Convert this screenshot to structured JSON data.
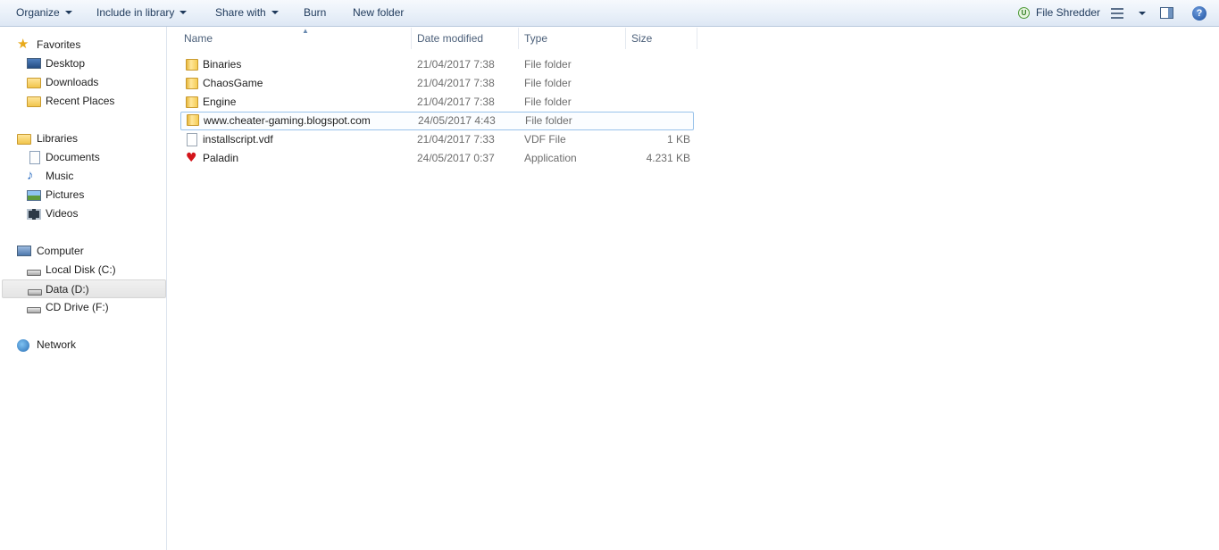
{
  "toolbar": {
    "organize": "Organize",
    "include_in_library": "Include in library",
    "share_with": "Share with",
    "burn": "Burn",
    "new_folder": "New folder",
    "file_shredder": "File Shredder",
    "file_shredder_icon_letter": "U",
    "help_glyph": "?"
  },
  "nav": {
    "favorites": {
      "label": "Favorites",
      "items": [
        "Desktop",
        "Downloads",
        "Recent Places"
      ]
    },
    "libraries": {
      "label": "Libraries",
      "items": [
        "Documents",
        "Music",
        "Pictures",
        "Videos"
      ]
    },
    "computer": {
      "label": "Computer",
      "items": [
        "Local Disk (C:)",
        "Data (D:)",
        "CD Drive (F:)"
      ],
      "selected": "Data (D:)"
    },
    "network": {
      "label": "Network"
    }
  },
  "columns": {
    "name": "Name",
    "date_modified": "Date modified",
    "type": "Type",
    "size": "Size"
  },
  "files": [
    {
      "name": "Binaries",
      "date": "21/04/2017 7:38",
      "type": "File folder",
      "size": "",
      "icon": "folder-icon"
    },
    {
      "name": "ChaosGame",
      "date": "21/04/2017 7:38",
      "type": "File folder",
      "size": "",
      "icon": "folder-icon"
    },
    {
      "name": "Engine",
      "date": "21/04/2017 7:38",
      "type": "File folder",
      "size": "",
      "icon": "folder-icon"
    },
    {
      "name": "www.cheater-gaming.blogspot.com",
      "date": "24/05/2017 4:43",
      "type": "File folder",
      "size": "",
      "icon": "folder-icon"
    },
    {
      "name": "installscript.vdf",
      "date": "21/04/2017 7:33",
      "type": "VDF File",
      "size": "1 KB",
      "icon": "file-icon"
    },
    {
      "name": "Paladin",
      "date": "24/05/2017 0:37",
      "type": "Application",
      "size": "4.231 KB",
      "icon": "paladin-app-icon"
    }
  ],
  "colors": {
    "toolbar_text": "#1e395b",
    "focus_border": "#99c2ea",
    "secondary_text": "#6d6d6d"
  }
}
